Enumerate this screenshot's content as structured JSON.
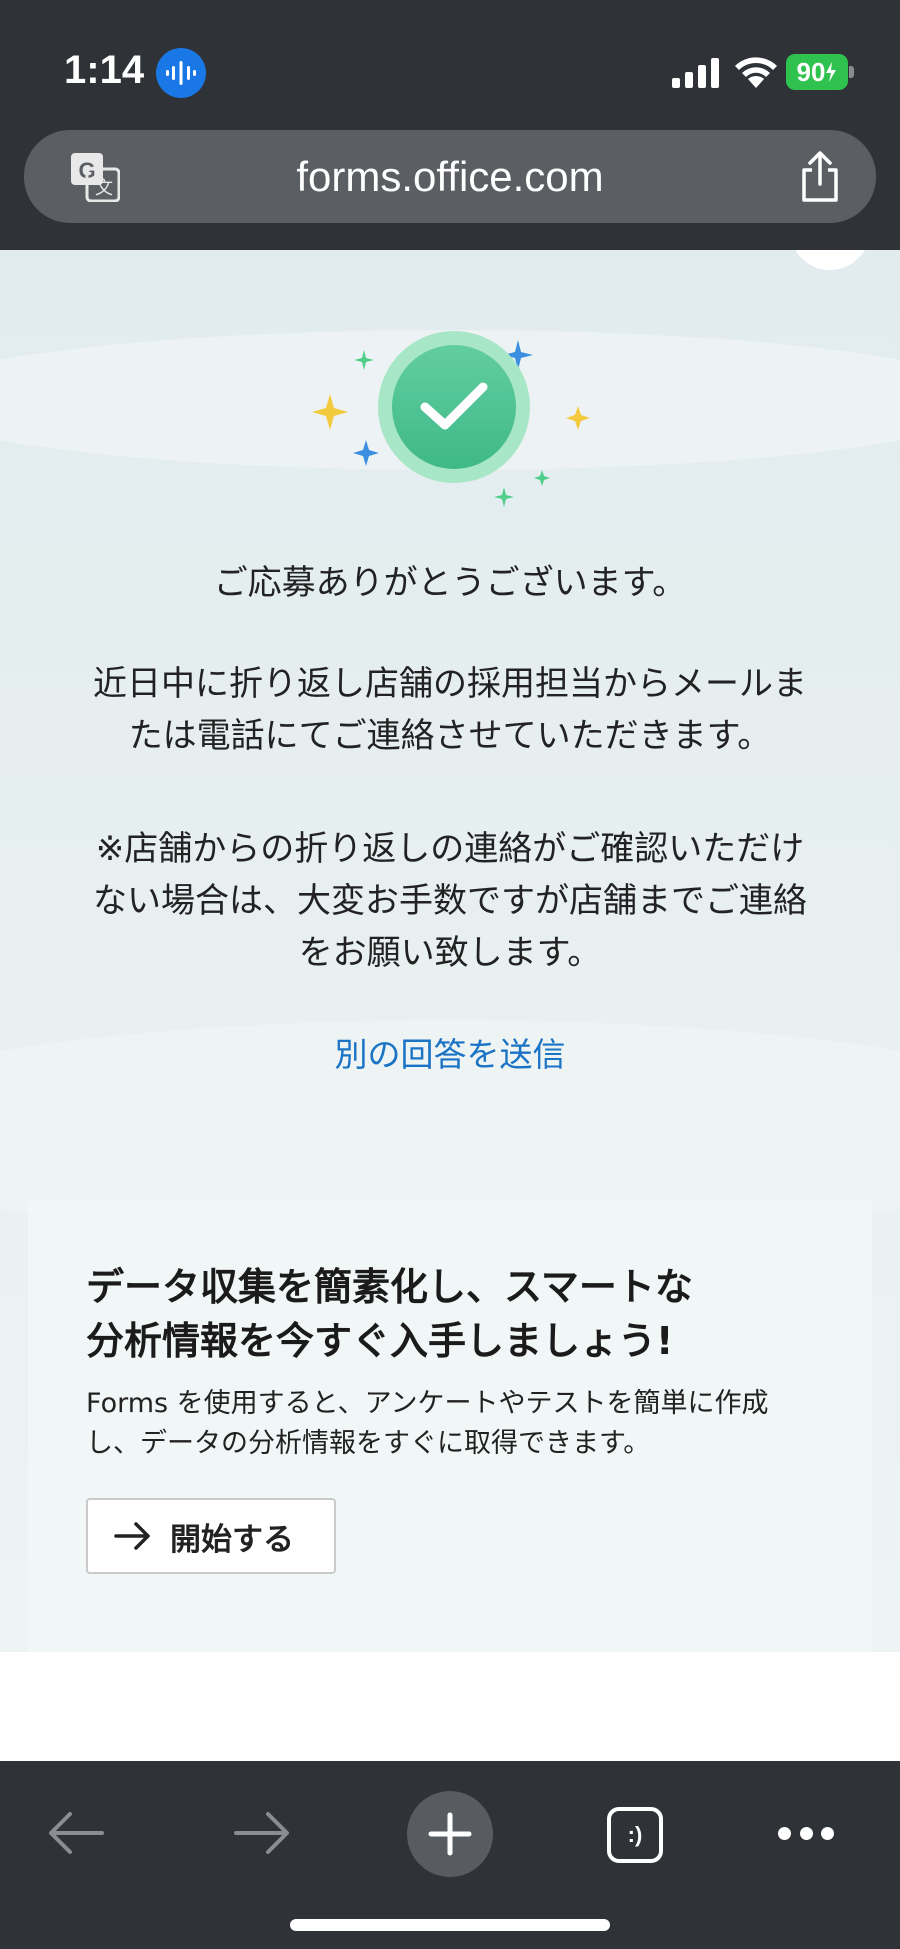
{
  "status_bar": {
    "time": "1:14",
    "battery": "90",
    "icons": [
      "voice-memo-icon",
      "cellular-signal-icon",
      "wifi-icon",
      "battery-charging-icon"
    ]
  },
  "browser": {
    "url": "forms.office.com",
    "icons": [
      "translate-icon",
      "share-icon"
    ]
  },
  "confirmation": {
    "thanks": "ご応募ありがとうございます。",
    "message1_line1": "近日中に折り返し店舗の採用担当からメールま",
    "message1_line2": "たは電話にてご連絡させていただきます。",
    "message2_line1": "※店舗からの折り返しの連絡がご確認いただけ",
    "message2_line2": "ない場合は、大変お手数ですが店舗までご連絡",
    "message2_line3": "をお願い致します。",
    "resend_link": "別の回答を送信"
  },
  "promo": {
    "title_line1": "データ収集を簡素化し、スマートな",
    "title_line2": "分析情報を今すぐ入手しましょう!",
    "desc_line1": "Forms を使用すると、アンケートやテストを簡単に作成",
    "desc_line2": "し、データの分析情報をすぐに取得できます。",
    "start_label": "開始する"
  },
  "toolbar": {
    "tabs_label": ":)",
    "icons": [
      "back-arrow-icon",
      "forward-arrow-icon",
      "plus-icon",
      "tabs-icon",
      "more-icon"
    ]
  },
  "colors": {
    "chrome": "#2f3236",
    "link": "#1a73c4",
    "success": "#3fb987",
    "battery": "#2fc24e"
  }
}
